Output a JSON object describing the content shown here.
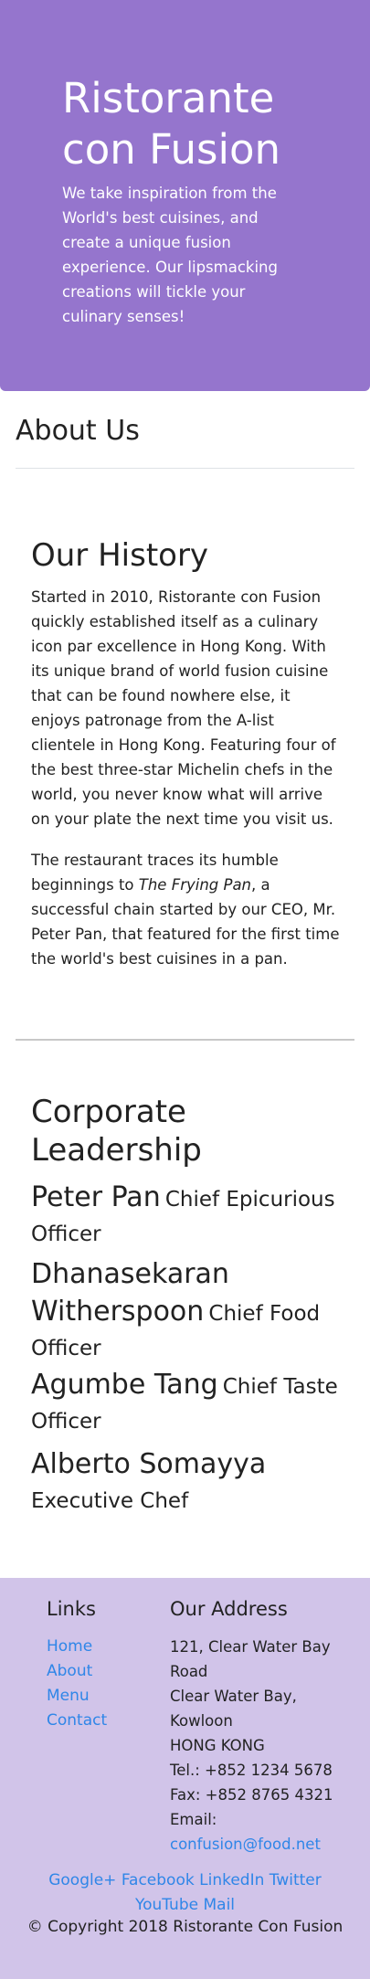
{
  "jumbotron": {
    "title": "Ristorante con Fusion",
    "text": "We take inspiration from the World's best cuisines, and create a unique fusion experience. Our lipsmacking creations will tickle your culinary senses!"
  },
  "about": {
    "heading": "About Us"
  },
  "history": {
    "heading": "Our History",
    "para1": "Started in 2010, Ristorante con Fusion quickly established itself as a culinary icon par excellence in Hong Kong. With its unique brand of world fusion cuisine that can be found nowhere else, it enjoys patronage from the A-list clientele in Hong Kong. Featuring four of the best three-star Michelin chefs in the world, you never know what will arrive on your plate the next time you visit us.",
    "para2_before": "The restaurant traces its humble beginnings to ",
    "para2_italic": "The Frying Pan",
    "para2_after": ", a successful chain started by our CEO, Mr. Peter Pan, that featured for the first time the world's best cuisines in a pan."
  },
  "leadership": {
    "heading": "Corporate Leadership",
    "leaders": [
      {
        "name": "Peter Pan",
        "role": "Chief Epicurious Officer"
      },
      {
        "name": "Dhanasekaran Witherspoon",
        "role": "Chief Food Officer"
      },
      {
        "name": "Agumbe Tang",
        "role": "Chief Taste Officer"
      },
      {
        "name": "Alberto Somayya",
        "role": "Executive Chef"
      }
    ]
  },
  "footer": {
    "links_heading": "Links",
    "links": [
      "Home",
      "About",
      "Menu",
      "Contact"
    ],
    "address_heading": "Our Address",
    "address_line1": "121, Clear Water Bay Road",
    "address_line2": "Clear Water Bay, Kowloon",
    "address_line3": "HONG KONG",
    "tel": "Tel.: +852 1234 5678",
    "fax": "Fax: +852 8765 4321",
    "email_label": "Email:",
    "email": "confusion@food.net",
    "social": [
      "Google+",
      "Facebook",
      "LinkedIn",
      "Twitter",
      "YouTube",
      "Mail"
    ],
    "copyright": "© Copyright 2018 Ristorante Con Fusion"
  },
  "colors": {
    "jumbotron_bg": "#9575cd",
    "footer_bg": "#d1c4e9",
    "link": "#2f86e8"
  }
}
